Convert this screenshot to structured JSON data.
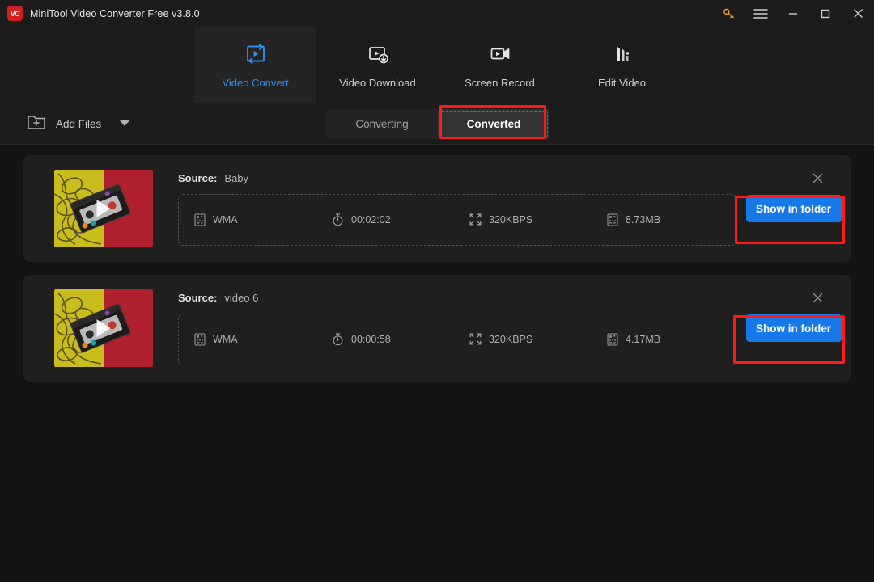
{
  "window": {
    "title": "MiniTool Video Converter Free v3.8.0",
    "logo_text": "VC",
    "controls": [
      {
        "name": "key-icon",
        "label": "Register"
      },
      {
        "name": "menu-icon",
        "label": "Menu"
      },
      {
        "name": "minimize-icon",
        "label": "Minimize"
      },
      {
        "name": "maximize-icon",
        "label": "Maximize"
      },
      {
        "name": "close-icon",
        "label": "Close"
      }
    ]
  },
  "nav": {
    "items": [
      {
        "label": "Video Convert",
        "icon": "video-convert-icon",
        "active": true
      },
      {
        "label": "Video Download",
        "icon": "video-download-icon",
        "active": false
      },
      {
        "label": "Screen Record",
        "icon": "screen-record-icon",
        "active": false
      },
      {
        "label": "Edit Video",
        "icon": "edit-video-icon",
        "active": false
      }
    ]
  },
  "toolbar": {
    "add_files_label": "Add Files",
    "add_files_icon": "folder-plus-icon",
    "dropdown_icon": "chevron-down-icon",
    "tabs": [
      {
        "label": "Converting",
        "active": false,
        "annotated": false
      },
      {
        "label": "Converted",
        "active": true,
        "annotated": true
      }
    ]
  },
  "colors": {
    "accent_blue": "#1778e8",
    "active_tab_text": "#2d8cf0",
    "annotation_red": "#ff1a17",
    "window_bg": "#1c1c1c",
    "content_bg": "#131313",
    "card_bg": "#1f1f1f"
  },
  "cards": [
    {
      "source_label": "Source:",
      "source_name": "Baby",
      "format": "WMA",
      "duration": "00:02:02",
      "bitrate": "320KBPS",
      "size": "8.73MB",
      "action_label": "Show in folder",
      "action_annotated": true,
      "close_icon": "close-icon",
      "thumbnail": "cassette-tape-thumbnail",
      "play_icon": "play-icon",
      "format_icon": "format-icon",
      "duration_icon": "stopwatch-icon",
      "bitrate_icon": "resolution-icon",
      "size_icon": "filesize-icon"
    },
    {
      "source_label": "Source:",
      "source_name": "video 6",
      "format": "WMA",
      "duration": "00:00:58",
      "bitrate": "320KBPS",
      "size": "4.17MB",
      "action_label": "Show in folder",
      "action_annotated": true,
      "close_icon": "close-icon",
      "thumbnail": "cassette-tape-thumbnail",
      "play_icon": "play-icon",
      "format_icon": "format-icon",
      "duration_icon": "stopwatch-icon",
      "bitrate_icon": "resolution-icon",
      "size_icon": "filesize-icon"
    }
  ]
}
